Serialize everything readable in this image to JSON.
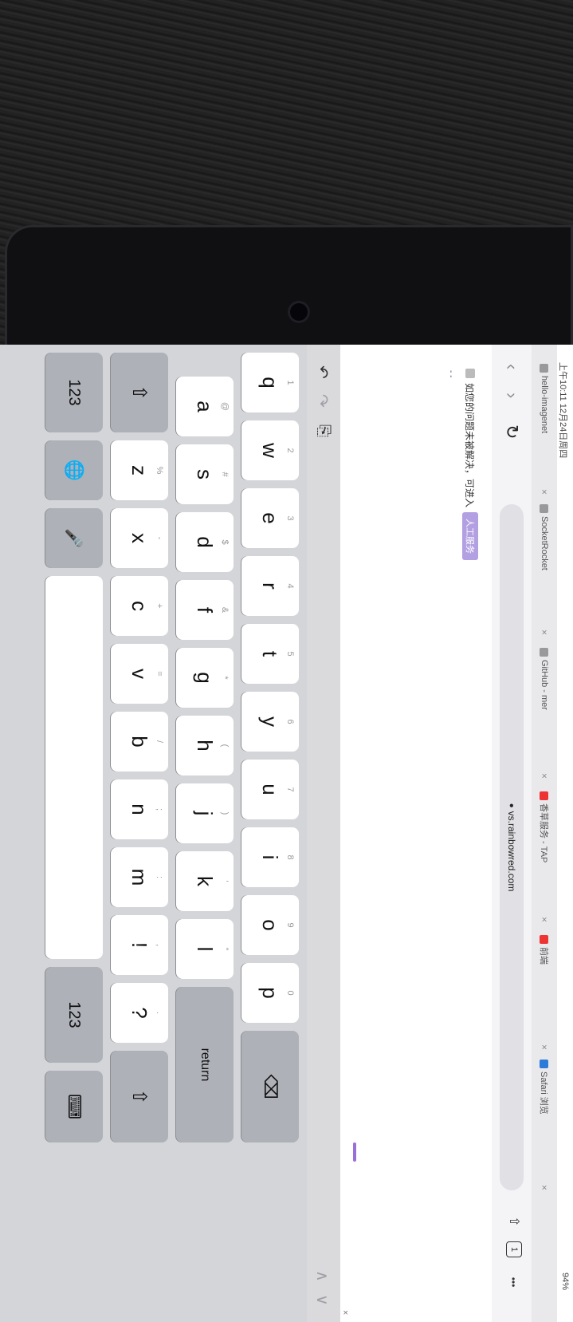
{
  "status": {
    "time_date": "上午10:11 12月24日周四",
    "battery": "94%"
  },
  "tabs": [
    {
      "label": "hello-imagenet",
      "close": "×"
    },
    {
      "label": "SocketRocket",
      "close": "×"
    },
    {
      "label": "GitHub - mer",
      "close": "×"
    },
    {
      "label": "香草服务 - TAP",
      "close": "×"
    },
    {
      "label": "前端",
      "close": "×"
    },
    {
      "label": "Safari 浏览",
      "close": "×"
    }
  ],
  "toolbar": {
    "back": "‹",
    "forward": "›",
    "reload": "↻",
    "url": "vs.rainbowred.com",
    "more": "•••"
  },
  "page": {
    "notice_text": "如您的问题未被解决，可进入",
    "notice_button": "人工服务",
    "ellipsis": "- -",
    "close": "×"
  },
  "shortcuts": {
    "undo": "↶",
    "redo": "↷",
    "paste": "⎘",
    "up": "∧",
    "down": "∨"
  },
  "keyboard": {
    "row1": [
      {
        "label": "q",
        "hint": "1"
      },
      {
        "label": "w",
        "hint": "2"
      },
      {
        "label": "e",
        "hint": "3"
      },
      {
        "label": "r",
        "hint": "4"
      },
      {
        "label": "t",
        "hint": "5"
      },
      {
        "label": "y",
        "hint": "6"
      },
      {
        "label": "u",
        "hint": "7"
      },
      {
        "label": "i",
        "hint": "8"
      },
      {
        "label": "o",
        "hint": "9"
      },
      {
        "label": "p",
        "hint": "0"
      }
    ],
    "row2": [
      {
        "label": "a",
        "hint": "@"
      },
      {
        "label": "s",
        "hint": "#"
      },
      {
        "label": "d",
        "hint": "$"
      },
      {
        "label": "f",
        "hint": "&"
      },
      {
        "label": "g",
        "hint": "*"
      },
      {
        "label": "h",
        "hint": "("
      },
      {
        "label": "j",
        "hint": ")"
      },
      {
        "label": "k",
        "hint": "'"
      },
      {
        "label": "l",
        "hint": "\""
      }
    ],
    "row3": [
      {
        "label": "z",
        "hint": "%"
      },
      {
        "label": "x",
        "hint": "-"
      },
      {
        "label": "c",
        "hint": "+"
      },
      {
        "label": "v",
        "hint": "="
      },
      {
        "label": "b",
        "hint": "/"
      },
      {
        "label": "n",
        "hint": ";"
      },
      {
        "label": "m",
        "hint": ":"
      },
      {
        "label": "!",
        "hint": ","
      },
      {
        "label": "?",
        "hint": "."
      }
    ],
    "delete": "⌫",
    "return": "return",
    "shift_left": "⇧",
    "shift_right": "⇧",
    "numbers_left": "123",
    "numbers_right": "123",
    "globe": "🌐",
    "mic": "🎤",
    "hide_keyboard": "⌨"
  }
}
